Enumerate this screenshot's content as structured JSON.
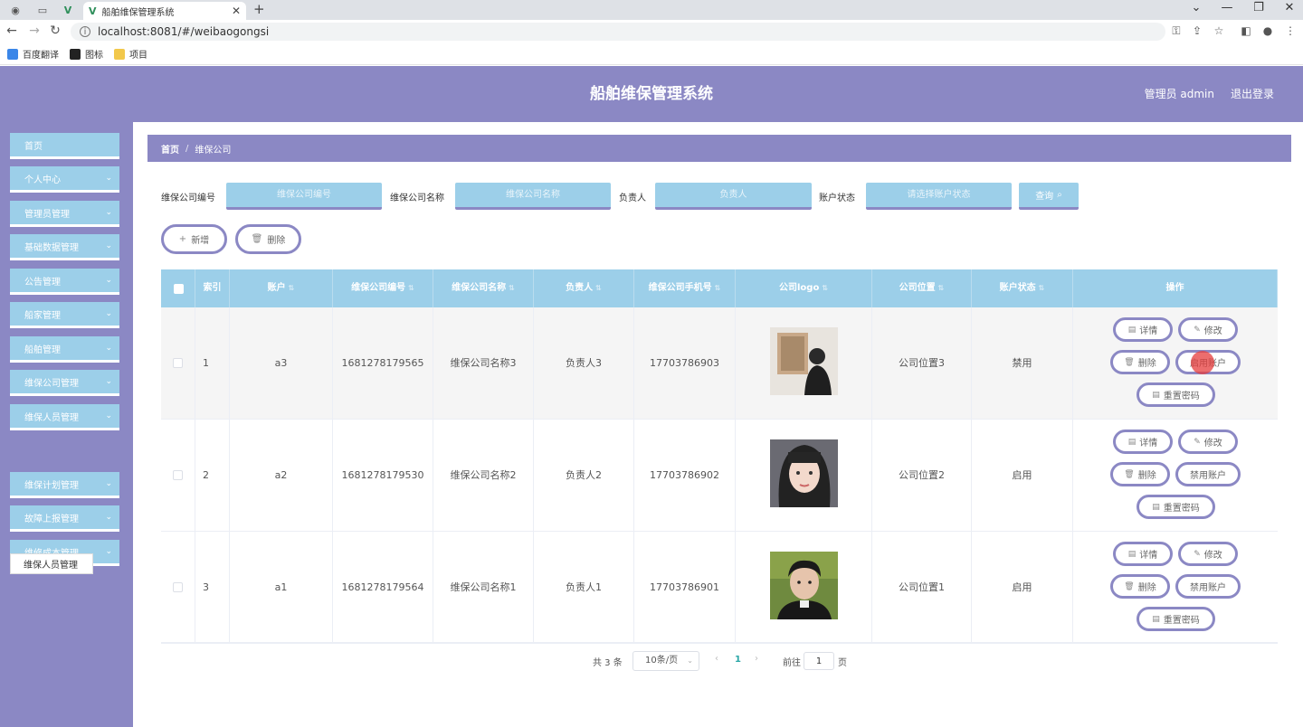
{
  "browser": {
    "tab_title": "船舶维保管理系统",
    "url": "localhost:8081/#/weibaogongsi",
    "bookmarks": [
      "百度翻译",
      "图标",
      "项目"
    ]
  },
  "colors": {
    "primary": "#8b88c4",
    "accent": "#9ccfe9",
    "current_page": "#2aa7a7"
  },
  "header": {
    "title": "船舶维保管理系统",
    "user": "管理员 admin",
    "logout": "退出登录"
  },
  "sidebar": {
    "items": [
      {
        "label": "首页",
        "expandable": false
      },
      {
        "label": "个人中心",
        "expandable": true
      },
      {
        "label": "管理员管理",
        "expandable": true
      },
      {
        "label": "基础数据管理",
        "expandable": true
      },
      {
        "label": "公告管理",
        "expandable": true
      },
      {
        "label": "船家管理",
        "expandable": true
      },
      {
        "label": "船舶管理",
        "expandable": true
      },
      {
        "label": "维保公司管理",
        "expandable": true
      },
      {
        "label": "维保人员管理",
        "expandable": true
      },
      {
        "label": "维保计划管理",
        "expandable": true
      },
      {
        "label": "故障上报管理",
        "expandable": true
      },
      {
        "label": "维修成本管理",
        "expandable": true
      }
    ],
    "submenu_item": "维保人员管理"
  },
  "breadcrumb": {
    "home": "首页",
    "separator": "/",
    "current": "维保公司"
  },
  "search": {
    "fields": [
      {
        "label": "维保公司编号",
        "placeholder": "维保公司编号"
      },
      {
        "label": "维保公司名称",
        "placeholder": "维保公司名称"
      },
      {
        "label": "负责人",
        "placeholder": "负责人"
      },
      {
        "label": "账户状态",
        "placeholder": "请选择账户状态"
      }
    ],
    "button": "查询"
  },
  "actions": {
    "add": "新增",
    "delete": "删除"
  },
  "table": {
    "columns": [
      "索引",
      "账户",
      "维保公司编号",
      "维保公司名称",
      "负责人",
      "维保公司手机号",
      "公司logo",
      "公司位置",
      "账户状态",
      "操作"
    ],
    "rows": [
      {
        "index": "1",
        "account": "a3",
        "code": "1681278179565",
        "name": "维保公司名称3",
        "manager": "负责人3",
        "phone": "17703786903",
        "location": "公司位置3",
        "status": "禁用",
        "toggle": "启用账户",
        "logo": "photo-person-gallery"
      },
      {
        "index": "2",
        "account": "a2",
        "code": "1681278179530",
        "name": "维保公司名称2",
        "manager": "负责人2",
        "phone": "17703786902",
        "location": "公司位置2",
        "status": "启用",
        "toggle": "禁用账户",
        "logo": "photo-woman-portrait"
      },
      {
        "index": "3",
        "account": "a1",
        "code": "1681278179564",
        "name": "维保公司名称1",
        "manager": "负责人1",
        "phone": "17703786901",
        "location": "公司位置1",
        "status": "启用",
        "toggle": "禁用账户",
        "logo": "photo-man-portrait"
      }
    ],
    "op_labels": {
      "detail": "详情",
      "edit": "修改",
      "delete": "删除",
      "reset": "重置密码"
    }
  },
  "pagination": {
    "total": "共 3 条",
    "page_size": "10条/页",
    "current": "1",
    "goto_label": "前往",
    "goto_value": "1",
    "page_suffix": "页"
  }
}
